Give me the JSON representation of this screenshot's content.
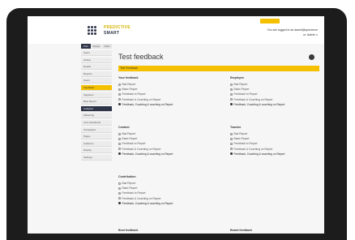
{
  "header": {
    "logo_line1": "PREDICTIVE",
    "logo_line2": "SMART",
    "user_line1": "You are logged in as daniel@spinnerce",
    "user_line2": "or: Admin v"
  },
  "sidebar": {
    "tabs": [
      "Print",
      "Design",
      "Table"
    ],
    "items": [
      "Users",
      "Orders",
      "Emails",
      "Reports",
      "Users",
      "Feedback",
      "Suppliers",
      "Best Report",
      "Analytics",
      "Marketing",
      "Care Standards",
      "Campaigns",
      "Pages",
      "Audience",
      "Display",
      "Settings"
    ]
  },
  "page": {
    "title": "Test feedback",
    "bar_label": "Test Feedback",
    "cards": [
      {
        "title": "Your feedback",
        "options": [
          "Bad Report",
          "Basic Report",
          "Feedback to Report",
          "Feedback & Coaching on Report",
          "Feedback, Coaching & coaching on Report"
        ],
        "selected": 4
      },
      {
        "title": "Employee",
        "options": [
          "Bad Report",
          "Basic Report",
          "Feedback to Report",
          "Feedback & Coaching on Report",
          "Feedback, Coaching & coaching on Report"
        ],
        "selected": 4
      },
      {
        "title": "Content",
        "options": [
          "Bad Report",
          "Basic Report",
          "Feedback to Report",
          "Feedback & Coaching on Report",
          "Feedback, Coaching & coaching on Report"
        ],
        "selected": 4
      },
      {
        "title": "Teacher",
        "options": [
          "Bad Report",
          "Basic Report",
          "Feedback to Report",
          "Feedback & Coaching on Report",
          "Feedback, Coaching & coaching on Report"
        ],
        "selected": 4
      },
      {
        "title": "Contribution",
        "options": [
          "Bad Report",
          "Basic Report",
          "Feedback to Report",
          "Feedback & Coaching on Report",
          "Feedback, Coaching & coaching on Report"
        ],
        "selected": 4
      },
      {
        "title": "Best feedback",
        "options": [],
        "selected": -1
      },
      {
        "title": "Board feedback",
        "options": [],
        "selected": -1
      }
    ]
  }
}
